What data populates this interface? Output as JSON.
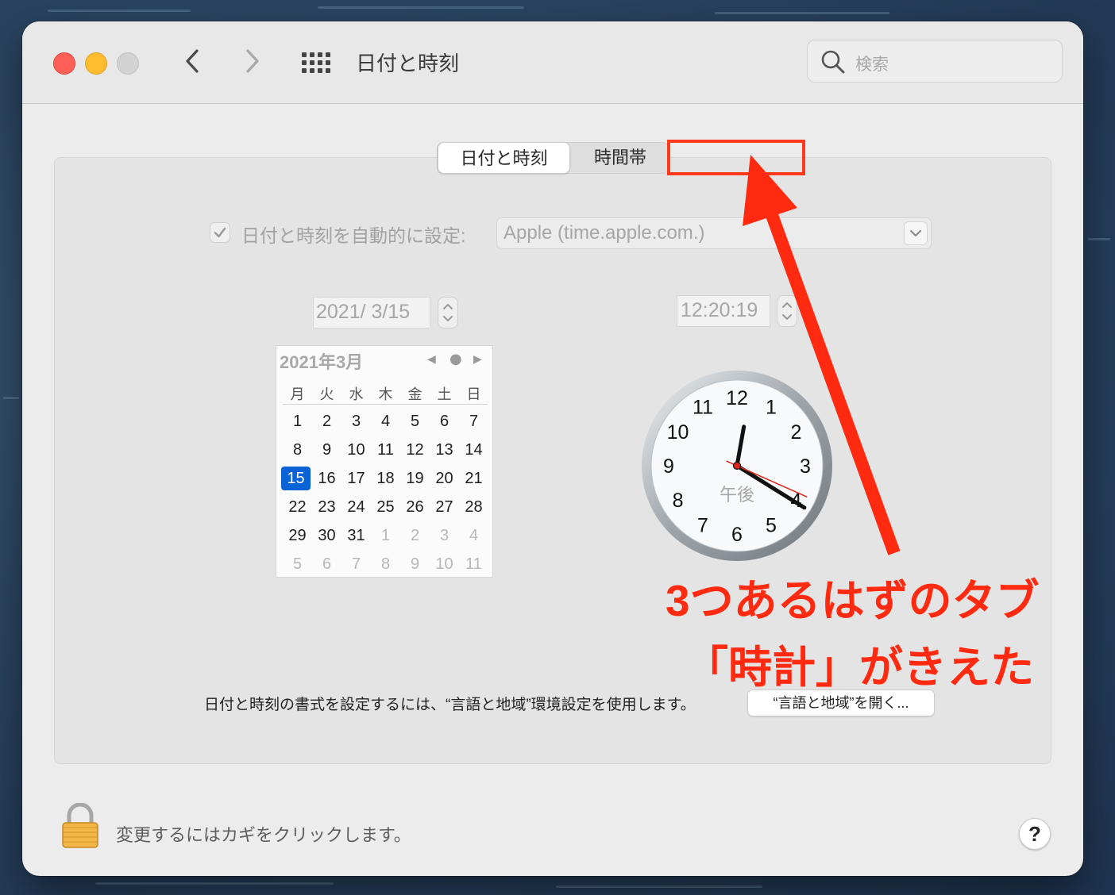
{
  "window": {
    "title": "日付と時刻"
  },
  "search": {
    "placeholder": "検索"
  },
  "tabs": [
    {
      "label": "日付と時刻",
      "selected": true
    },
    {
      "label": "時間帯",
      "selected": false
    }
  ],
  "auto_set": {
    "checked": true,
    "label": "日付と時刻を自動的に設定:",
    "server": "Apple (time.apple.com.)"
  },
  "date_field": {
    "value": "2021/  3/15"
  },
  "time_field": {
    "value": "12:20:19"
  },
  "calendar": {
    "title": "2021年3月",
    "weekdays": [
      "月",
      "火",
      "水",
      "木",
      "金",
      "土",
      "日"
    ],
    "selected_day": "15",
    "weeks": [
      [
        "1",
        "2",
        "3",
        "4",
        "5",
        "6",
        "7"
      ],
      [
        "8",
        "9",
        "10",
        "11",
        "12",
        "13",
        "14"
      ],
      [
        "15",
        "16",
        "17",
        "18",
        "19",
        "20",
        "21"
      ],
      [
        "22",
        "23",
        "24",
        "25",
        "26",
        "27",
        "28"
      ],
      [
        "29",
        "30",
        "31",
        "1",
        "2",
        "3",
        "4"
      ],
      [
        "5",
        "6",
        "7",
        "8",
        "9",
        "10",
        "11"
      ]
    ],
    "outside_month_from_index": 31
  },
  "clock": {
    "ampm": "午後",
    "numbers": [
      "12",
      "1",
      "2",
      "3",
      "4",
      "5",
      "6",
      "7",
      "8",
      "9",
      "10",
      "11"
    ],
    "hour": 12,
    "minute": 20,
    "second": 19
  },
  "format_note": {
    "text": "日付と時刻の書式を設定するには、“言語と地域”環境設定を使用します。",
    "button": "“言語と地域”を開く..."
  },
  "lock": {
    "text": "変更するにはカギをクリックします。"
  },
  "help": {
    "label": "?"
  },
  "annotation": {
    "line1": "3つあるはずのタブ",
    "line2": "「時計」がきえた",
    "color": "#ff2a10"
  },
  "colors": {
    "accent": "#0a63d6",
    "close": "#fe5f57",
    "minimize": "#febc2e"
  }
}
